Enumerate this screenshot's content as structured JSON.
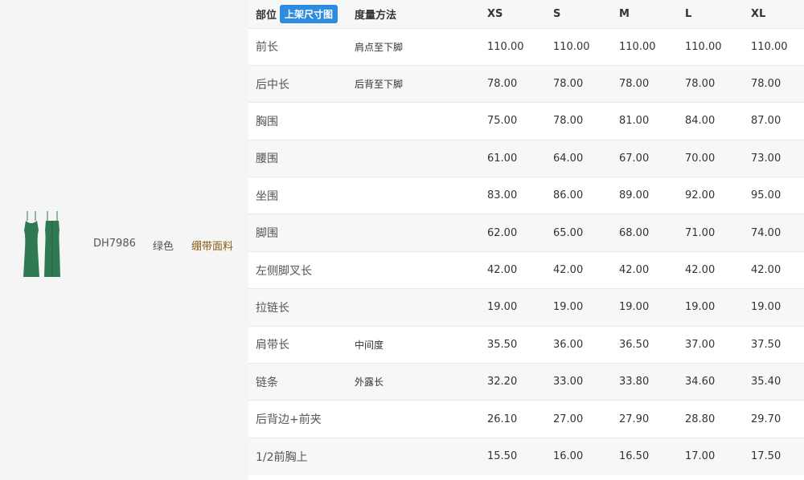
{
  "product": {
    "image_icon": "dress-thumbnail-icon",
    "sku": "DH7986",
    "color": "绿色",
    "fabric": "绷带面料",
    "dress_color": "#2f7a52"
  },
  "table": {
    "header": {
      "part": "部位",
      "badge": "上架尺寸图",
      "method": "度量方法",
      "sizes": [
        "XS",
        "S",
        "M",
        "L",
        "XL"
      ]
    },
    "rows": [
      {
        "part": "前长",
        "method": "肩点至下脚",
        "values": [
          "110.00",
          "110.00",
          "110.00",
          "110.00",
          "110.00"
        ]
      },
      {
        "part": "后中长",
        "method": "后背至下脚",
        "values": [
          "78.00",
          "78.00",
          "78.00",
          "78.00",
          "78.00"
        ]
      },
      {
        "part": "胸围",
        "method": "",
        "values": [
          "75.00",
          "78.00",
          "81.00",
          "84.00",
          "87.00"
        ]
      },
      {
        "part": "腰围",
        "method": "",
        "values": [
          "61.00",
          "64.00",
          "67.00",
          "70.00",
          "73.00"
        ]
      },
      {
        "part": "坐围",
        "method": "",
        "values": [
          "83.00",
          "86.00",
          "89.00",
          "92.00",
          "95.00"
        ]
      },
      {
        "part": "脚围",
        "method": "",
        "values": [
          "62.00",
          "65.00",
          "68.00",
          "71.00",
          "74.00"
        ]
      },
      {
        "part": "左侧脚叉长",
        "method": "",
        "values": [
          "42.00",
          "42.00",
          "42.00",
          "42.00",
          "42.00"
        ]
      },
      {
        "part": "拉链长",
        "method": "",
        "values": [
          "19.00",
          "19.00",
          "19.00",
          "19.00",
          "19.00"
        ]
      },
      {
        "part": "肩带长",
        "method": "中间度",
        "values": [
          "35.50",
          "36.00",
          "36.50",
          "37.00",
          "37.50"
        ]
      },
      {
        "part": "链条",
        "method": "外露长",
        "values": [
          "32.20",
          "33.00",
          "33.80",
          "34.60",
          "35.40"
        ]
      },
      {
        "part": "后背边+前夹",
        "method": "",
        "values": [
          "26.10",
          "27.00",
          "27.90",
          "28.80",
          "29.70"
        ]
      },
      {
        "part": "1/2前胸上",
        "method": "",
        "values": [
          "15.50",
          "16.00",
          "16.50",
          "17.00",
          "17.50"
        ]
      }
    ]
  }
}
